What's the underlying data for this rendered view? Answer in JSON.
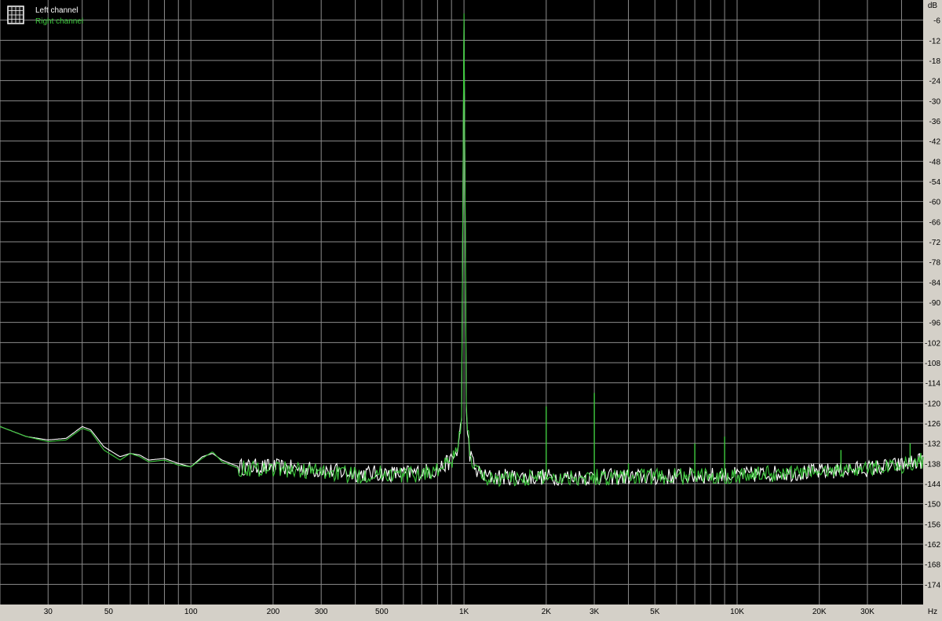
{
  "colors": {
    "background": "#000000",
    "grid": "#8c8c8c",
    "axis_panel": "#d4d0c8",
    "left_channel": "#ffffff",
    "right_channel": "#3cc83c"
  },
  "legend": {
    "icon": "grid-icon",
    "placement": "top-left",
    "entries": [
      "Left channel",
      "Right channel"
    ]
  },
  "chart_data": {
    "type": "line",
    "x_scale": "log",
    "xlim": [
      20,
      48000
    ],
    "ylim": [
      -180,
      0
    ],
    "grid": true,
    "xunit": "Hz",
    "yunit": "dB",
    "x_ticks": [
      30,
      50,
      100,
      200,
      300,
      500,
      1000,
      2000,
      3000,
      5000,
      10000,
      20000,
      30000
    ],
    "x_tick_labels": [
      "30",
      "50",
      "100",
      "200",
      "300",
      "500",
      "1K",
      "2K",
      "3K",
      "5K",
      "10K",
      "20K",
      "30K"
    ],
    "y_ticks": [
      -6,
      -12,
      -18,
      -24,
      -30,
      -36,
      -42,
      -48,
      -54,
      -60,
      -66,
      -72,
      -78,
      -84,
      -90,
      -96,
      -102,
      -108,
      -114,
      -120,
      -126,
      -132,
      -138,
      -144,
      -150,
      -156,
      -162,
      -168,
      -174
    ],
    "y_tick_labels": [
      "-6",
      "-12",
      "-18",
      "-24",
      "-30",
      "-36",
      "-42",
      "-48",
      "-54",
      "-60",
      "-66",
      "-72",
      "-78",
      "-84",
      "-90",
      "-96",
      "-102",
      "-108",
      "-114",
      "-120",
      "-126",
      "-132",
      "-138",
      "-144",
      "-150",
      "-156",
      "-162",
      "-168",
      "-174"
    ],
    "series": [
      {
        "name": "Left channel",
        "color": "#ffffff",
        "x": [
          20,
          25,
          30,
          35,
          40,
          43,
          48,
          55,
          60,
          65,
          70,
          80,
          90,
          100,
          110,
          120,
          130,
          150,
          200,
          300,
          400,
          500,
          600,
          700,
          800,
          900,
          950,
          980,
          1000,
          1020,
          1050,
          1100,
          1200,
          1500,
          2000,
          3000,
          5000,
          10000,
          20000,
          30000,
          40000,
          48000
        ],
        "y": [
          -127,
          -130,
          -131,
          -130.5,
          -127,
          -128,
          -133,
          -136,
          -135,
          -135.5,
          -137,
          -136.5,
          -138,
          -139,
          -136,
          -135,
          -137,
          -139,
          -139,
          -140,
          -141,
          -141,
          -141,
          -140.5,
          -140,
          -137,
          -134,
          -125,
          -6,
          -125,
          -135,
          -140,
          -142,
          -142,
          -142,
          -142,
          -142,
          -141.5,
          -140.5,
          -139.5,
          -138.5,
          -137
        ]
      },
      {
        "name": "Right channel",
        "color": "#3cc83c",
        "x": [
          20,
          25,
          30,
          35,
          40,
          43,
          48,
          55,
          60,
          65,
          70,
          80,
          90,
          100,
          110,
          120,
          130,
          150,
          200,
          300,
          400,
          500,
          600,
          700,
          800,
          900,
          950,
          980,
          1000,
          1020,
          1050,
          1100,
          1200,
          1500,
          2000,
          3000,
          5000,
          10000,
          20000,
          30000,
          40000,
          48000
        ],
        "y": [
          -127,
          -130,
          -131.5,
          -131,
          -127.5,
          -128.5,
          -134,
          -137,
          -135,
          -136,
          -137.5,
          -137,
          -138.5,
          -139,
          -136.5,
          -134.5,
          -137.5,
          -139.5,
          -139.5,
          -140.5,
          -141.5,
          -141,
          -141.5,
          -141,
          -140,
          -137.5,
          -134,
          -124,
          -4,
          -123,
          -134,
          -140,
          -142.5,
          -142.5,
          -142,
          -142,
          -142,
          -141.5,
          -140.5,
          -139.5,
          -138.5,
          -137
        ],
        "spikes": [
          {
            "x": 2000,
            "y": -121
          },
          {
            "x": 3000,
            "y": -117
          },
          {
            "x": 4000,
            "y": -138
          },
          {
            "x": 7000,
            "y": -132
          },
          {
            "x": 9000,
            "y": -130
          },
          {
            "x": 24000,
            "y": -134
          },
          {
            "x": 43000,
            "y": -132
          }
        ]
      }
    ]
  }
}
